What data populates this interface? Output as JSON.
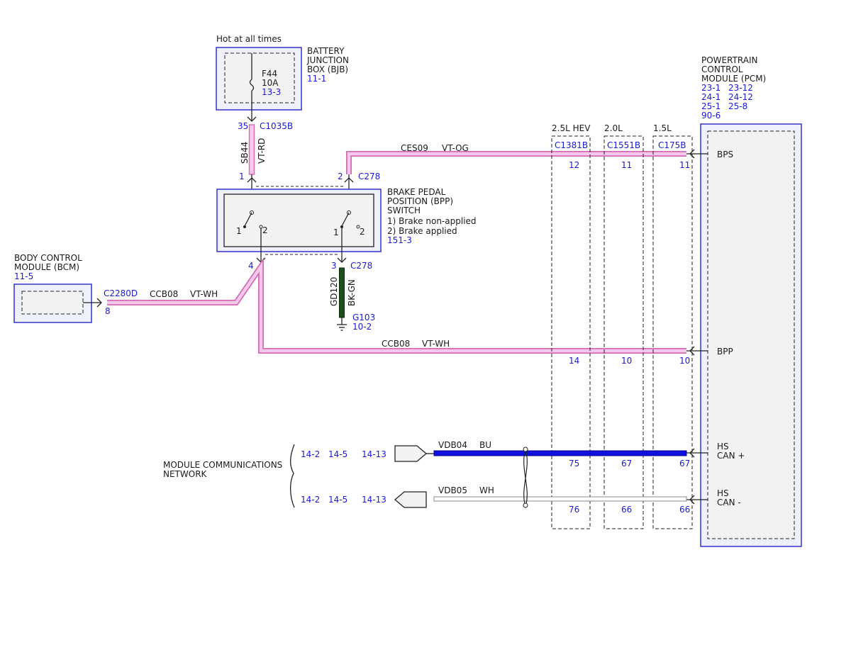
{
  "colors": {
    "wire_vt": "#d36bb5",
    "wire_vt_light": "#f6c9ea",
    "wire_bu": "#1010e0",
    "wire_bk_gn": "#1d4d1d",
    "module_border": "#3333cc",
    "ref_text": "#1a1ad6"
  },
  "top": {
    "hot_label": "Hot at all times"
  },
  "bjb": {
    "name_lines": [
      "BATTERY",
      "JUNCTION",
      "BOX (BJB)"
    ],
    "ref": "11-1",
    "fuse_name": "F44",
    "fuse_rating": "10A",
    "fuse_ref": "13-3",
    "pin": "35",
    "connector": "C1035B"
  },
  "wire_sb44": {
    "circuit": "SB44",
    "color": "VT-RD"
  },
  "bpp": {
    "name_lines": [
      "BRAKE PEDAL",
      "POSITION (BPP)",
      "SWITCH"
    ],
    "note1": "1) Brake non-applied",
    "note2": "2) Brake applied",
    "ref": "151-3",
    "pin1": "1",
    "pin2": "2",
    "pin3": "3",
    "pin4": "4",
    "connector": "C278",
    "sw_a_pos1": "1",
    "sw_a_pos2": "2",
    "sw_b_pos1": "1",
    "sw_b_pos2": "2"
  },
  "wire_ces09": {
    "circuit": "CES09",
    "color": "VT-OG"
  },
  "bcm": {
    "name_lines": [
      "BODY CONTROL",
      "MODULE (BCM)"
    ],
    "ref": "11-5",
    "connector": "C2280D",
    "pin": "8"
  },
  "wire_ccb08_left": {
    "circuit": "CCB08",
    "color": "VT-WH"
  },
  "wire_ccb08_right": {
    "circuit": "CCB08",
    "color": "VT-WH"
  },
  "ground": {
    "circuit": "GD120",
    "color": "BK-GN",
    "name": "G103",
    "ref": "10-2"
  },
  "pcm": {
    "name_lines": [
      "POWERTRAIN",
      "CONTROL",
      "MODULE (PCM)"
    ],
    "refs": [
      [
        "23-1",
        "23-12"
      ],
      [
        "24-1",
        "24-12"
      ],
      [
        "25-1",
        "25-8"
      ],
      [
        "90-6"
      ]
    ],
    "sig_bps": "BPS",
    "sig_bpp": "BPP",
    "sig_hs1": "HS",
    "sig_canp": "CAN +",
    "sig_hs2": "HS",
    "sig_canm": "CAN -"
  },
  "variants": [
    {
      "label": "2.5L HEV",
      "connector": "C1381B",
      "bps": "12",
      "bpp": "14",
      "canp": "75",
      "canm": "76"
    },
    {
      "label": "2.0L",
      "connector": "C1551B",
      "bps": "11",
      "bpp": "10",
      "canp": "67",
      "canm": "66"
    },
    {
      "label": "1.5L",
      "connector": "C175B",
      "bps": "11",
      "bpp": "10",
      "canp": "67",
      "canm": "66"
    }
  ],
  "network": {
    "label_lines": [
      "MODULE COMMUNICATIONS",
      "NETWORK"
    ],
    "refs_top": [
      "14-2",
      "14-5",
      "14-13"
    ],
    "refs_bottom": [
      "14-2",
      "14-5",
      "14-13"
    ],
    "wire_top": {
      "circuit": "VDB04",
      "color": "BU"
    },
    "wire_bottom": {
      "circuit": "VDB05",
      "color": "WH"
    }
  }
}
